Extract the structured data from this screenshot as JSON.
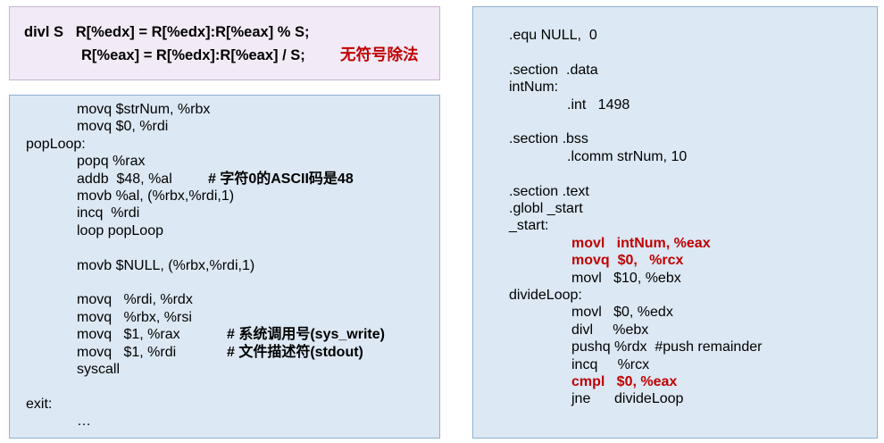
{
  "divl_box": {
    "line1": "divl S   R[%edx] = R[%edx]:R[%eax] % S;",
    "line2": "R[%eax] = R[%edx]:R[%eax] / S;",
    "note": "无符号除法"
  },
  "left_code": [
    {
      "text": "movq $strNum, %rbx",
      "indent": 1
    },
    {
      "text": "movq $0, %rdi",
      "indent": 1
    },
    {
      "text": "popLoop:",
      "indent": 0
    },
    {
      "text": "popq %rax",
      "indent": 1
    },
    {
      "text": "addb  $48, %al",
      "indent": 1,
      "comment": "# 字符0的ASCII码是48"
    },
    {
      "text": "movb %al, (%rbx,%rdi,1)",
      "indent": 1
    },
    {
      "text": "incq  %rdi",
      "indent": 1
    },
    {
      "text": "loop popLoop",
      "indent": 1
    },
    {
      "text": "",
      "indent": 0
    },
    {
      "text": "movb $NULL, (%rbx,%rdi,1)",
      "indent": 1
    },
    {
      "text": "",
      "indent": 0
    },
    {
      "text": "movq   %rdi, %rdx",
      "indent": 1
    },
    {
      "text": "movq   %rbx, %rsi",
      "indent": 1
    },
    {
      "text": "movq   $1, %rax",
      "indent": 1,
      "comment": "# 系统调用号(sys_write)"
    },
    {
      "text": "movq   $1, %rdi",
      "indent": 1,
      "comment": "# 文件描述符(stdout)"
    },
    {
      "text": "syscall",
      "indent": 1
    },
    {
      "text": "",
      "indent": 0
    },
    {
      "text": "exit:",
      "indent": 0
    },
    {
      "text": "…",
      "indent": 1
    }
  ],
  "right_code": [
    {
      "text": ".equ NULL,  0",
      "indent": 0
    },
    {
      "text": "",
      "indent": 0
    },
    {
      "text": ".section  .data",
      "indent": 0
    },
    {
      "text": "intNum:",
      "indent": 0
    },
    {
      "text": ".int   1498",
      "indent": 1
    },
    {
      "text": "",
      "indent": 0
    },
    {
      "text": ".section .bss",
      "indent": 0
    },
    {
      "text": ".lcomm strNum, 10",
      "indent": 1
    },
    {
      "text": "",
      "indent": 0
    },
    {
      "text": ".section .text",
      "indent": 0
    },
    {
      "text": ".globl _start",
      "indent": 0
    },
    {
      "text": "_start:",
      "indent": 0
    },
    {
      "text": "movl   intNum, %eax",
      "indent": 2,
      "highlight": true
    },
    {
      "text": "movq  $0,   %rcx",
      "indent": 2,
      "highlight": true
    },
    {
      "text": "movl   $10, %ebx",
      "indent": 2
    },
    {
      "text": "divideLoop:",
      "indent": 0
    },
    {
      "text": "movl   $0, %edx",
      "indent": 2
    },
    {
      "text": "divl     %ebx",
      "indent": 2
    },
    {
      "text": "pushq %rdx  #push remainder",
      "indent": 2
    },
    {
      "text": "incq     %rcx",
      "indent": 2
    },
    {
      "text": "cmpl   $0, %eax",
      "indent": 2,
      "highlight": true
    },
    {
      "text": "jne      divideLoop",
      "indent": 2
    }
  ],
  "colors": {
    "highlight": "#c00000",
    "code_box_bg": "#dce8f3",
    "divl_box_bg": "#f2eaf6"
  }
}
